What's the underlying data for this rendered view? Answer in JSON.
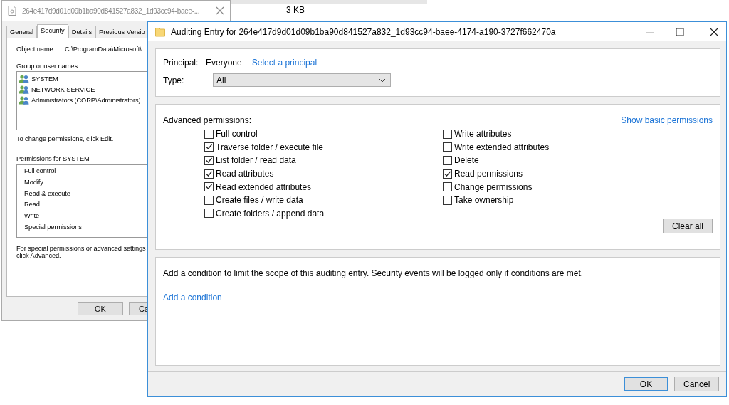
{
  "background": {
    "size": "3 KB"
  },
  "properties_window": {
    "title": "264e417d9d01d09b1ba90d841527a832_1d93cc94-baee-...",
    "tabs": [
      {
        "label": "General",
        "selected": false
      },
      {
        "label": "Security",
        "selected": true
      },
      {
        "label": "Details",
        "selected": false
      },
      {
        "label": "Previous Versio",
        "selected": false
      }
    ],
    "object_name_label": "Object name:",
    "object_name": "C:\\ProgramData\\Microsoft\\",
    "group_label": "Group or user names:",
    "groups": [
      "SYSTEM",
      "NETWORK SERVICE",
      "Administrators (CORP\\Administrators)"
    ],
    "change_note": "To change permissions, click Edit.",
    "permissions_label": "Permissions for SYSTEM",
    "permissions": [
      "Full control",
      "Modify",
      "Read & execute",
      "Read",
      "Write",
      "Special permissions"
    ],
    "advanced_note": [
      "For special permissions or advanced settings",
      "click Advanced."
    ],
    "buttons": [
      "OK",
      "Ca"
    ]
  },
  "auditing_dialog": {
    "title": "Auditing Entry for 264e417d9d01d09b1ba90d841527a832_1d93cc94-baee-4174-a190-3727f662470a",
    "principal_label": "Principal:",
    "principal": "Everyone",
    "select_principal_link": "Select a principal",
    "type_label": "Type:",
    "type_value": "All",
    "advanced_label": "Advanced permissions:",
    "show_basic_link": "Show basic permissions",
    "columns": [
      [
        {
          "label": "Full control",
          "checked": false
        },
        {
          "label": "Traverse folder / execute file",
          "checked": true
        },
        {
          "label": "List folder / read data",
          "checked": true
        },
        {
          "label": "Read attributes",
          "checked": true
        },
        {
          "label": "Read extended attributes",
          "checked": true
        },
        {
          "label": "Create files / write data",
          "checked": false
        },
        {
          "label": "Create folders / append data",
          "checked": false
        }
      ],
      [
        {
          "label": "Write attributes",
          "checked": false
        },
        {
          "label": "Write extended attributes",
          "checked": false
        },
        {
          "label": "Delete",
          "checked": false
        },
        {
          "label": "Read permissions",
          "checked": true
        },
        {
          "label": "Change permissions",
          "checked": false
        },
        {
          "label": "Take ownership",
          "checked": false
        }
      ]
    ],
    "clear_all_button": "Clear all",
    "condition_note": "Add a condition to limit the scope of this auditing entry. Security events will be logged only if conditions are met.",
    "add_condition_link": "Add a condition",
    "buttons": [
      {
        "label": "OK",
        "default": true
      },
      {
        "label": "Cancel",
        "default": false
      }
    ]
  }
}
